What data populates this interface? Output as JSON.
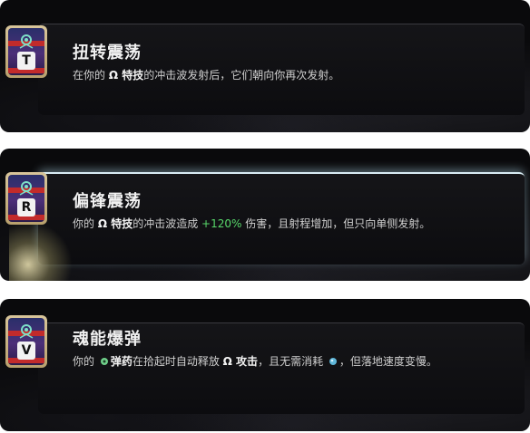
{
  "boons": [
    {
      "key": "T",
      "title": "扭转震荡",
      "desc": [
        {
          "t": "text",
          "v": "在你的 "
        },
        {
          "t": "hl",
          "v": "Ω 特技"
        },
        {
          "t": "text",
          "v": "的冲击波发射后，它们朝向你再次发射。"
        }
      ],
      "selected": false
    },
    {
      "key": "R",
      "title": "偏锋震荡",
      "desc": [
        {
          "t": "text",
          "v": "你的 "
        },
        {
          "t": "hl",
          "v": "Ω 特技"
        },
        {
          "t": "text",
          "v": "的冲击波造成 "
        },
        {
          "t": "green",
          "v": "+120%"
        },
        {
          "t": "text",
          "v": " 伤害，且射程增加，但只向单侧发射。"
        }
      ],
      "selected": true
    },
    {
      "key": "V",
      "title": "魂能爆弹",
      "desc": [
        {
          "t": "text",
          "v": "你的 "
        },
        {
          "t": "icon",
          "v": "ammo-icon"
        },
        {
          "t": "hl",
          "v": "弹药"
        },
        {
          "t": "text",
          "v": "在拾起时自动释放 "
        },
        {
          "t": "hl",
          "v": "Ω 攻击"
        },
        {
          "t": "text",
          "v": "，且无需消耗 "
        },
        {
          "t": "icon",
          "v": "magick-icon"
        },
        {
          "t": "text",
          "v": "，但落地速度变慢。"
        }
      ],
      "selected": false
    }
  ],
  "colors": {
    "card_bg": "#0a0a0c",
    "title": "#f0f0f0",
    "desc": "#cfcfcf",
    "highlight_green": "#58d86a",
    "badge_gold": "#d8c59a",
    "badge_red": "#c22b2b"
  }
}
